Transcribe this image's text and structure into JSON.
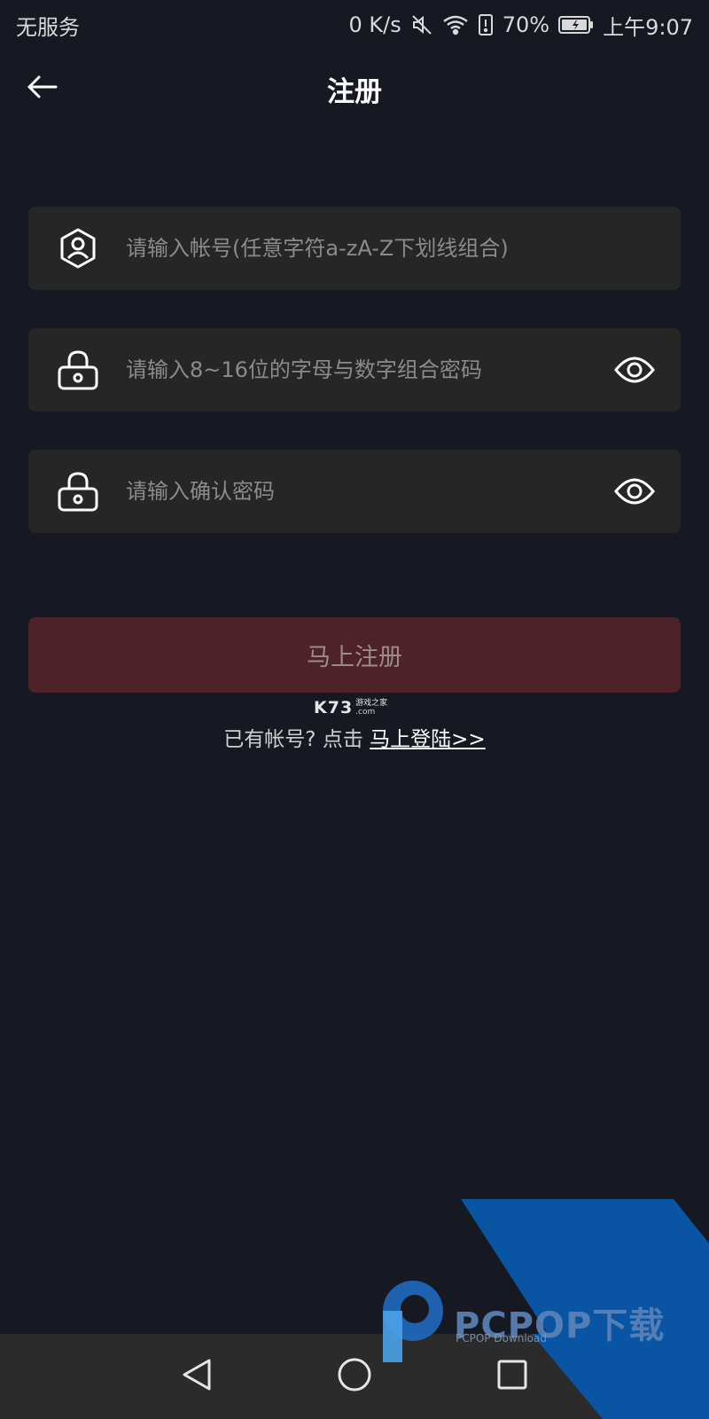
{
  "status_bar": {
    "carrier": "无服务",
    "net_speed": "0 K/s",
    "battery": "70%",
    "time": "上午9:07"
  },
  "header": {
    "title": "注册"
  },
  "form": {
    "account_placeholder": "请输入帐号(任意字符a-zA-Z下划线组合)",
    "password_placeholder": "请输入8~16位的字母与数字组合密码",
    "confirm_placeholder": "请输入确认密码",
    "submit_label": "马上注册",
    "has_account_text": "已有帐号? 点击 ",
    "login_link": "马上登陆>>"
  },
  "watermarks": {
    "k73": "K73",
    "k73_sub": "游戏之家",
    "k73_domain": ".com",
    "pcpop": "PCPOP下载",
    "pcpop_sub": "PCPOP Download"
  },
  "icons": {
    "back": "arrow-left-icon",
    "account": "user-hexagon-icon",
    "lock": "lock-icon",
    "eye": "eye-icon",
    "nav_back": "triangle-back-icon",
    "nav_home": "circle-home-icon",
    "nav_recent": "square-recent-icon"
  },
  "colors": {
    "background": "#171922",
    "field": "#262626",
    "button": "#4d2228",
    "button_text": "#9c8a8c"
  }
}
